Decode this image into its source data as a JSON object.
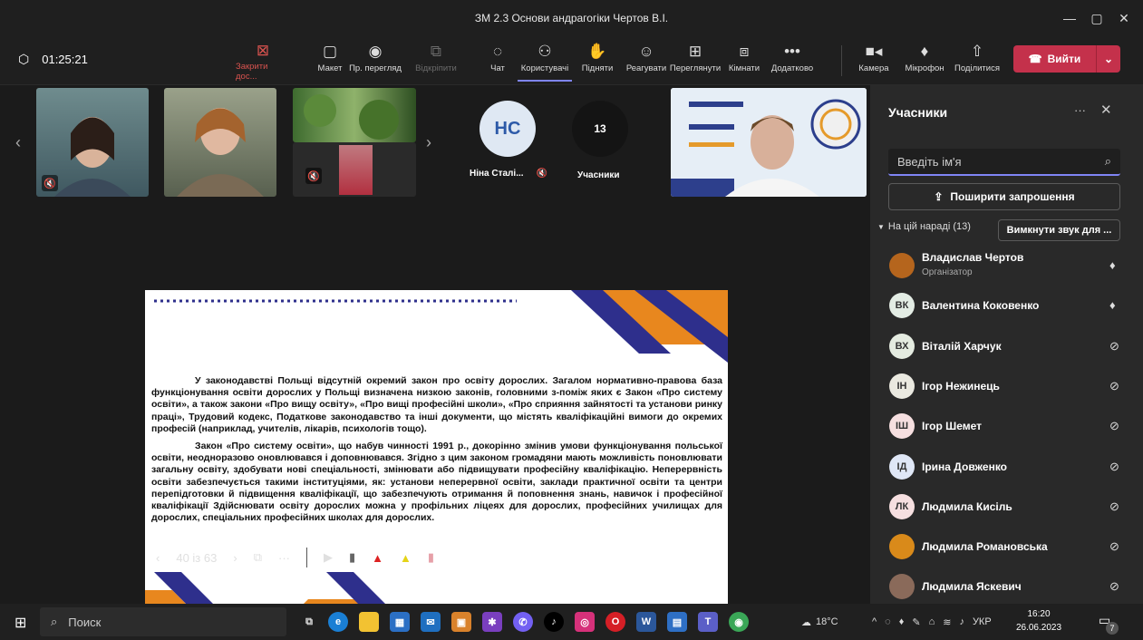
{
  "window": {
    "title": "ЗМ 2.3 Основи андрагогіки Чертов В.І.",
    "minimize": "—",
    "maximize": "▢",
    "close": "✕"
  },
  "meeting": {
    "timer": "01:25:21"
  },
  "toolbar": {
    "buttons": [
      {
        "label": "Закрити дос...",
        "icon": "close-share-icon",
        "glyph": "⊠"
      },
      {
        "label": "Макет",
        "icon": "layout-icon",
        "glyph": "▢"
      },
      {
        "label": "Пр. перегляд",
        "icon": "preview-eye-icon",
        "glyph": "◉"
      },
      {
        "label": "Відкріпити",
        "icon": "popout-icon",
        "glyph": "⧉"
      },
      {
        "label": "Чат",
        "icon": "chat-icon",
        "glyph": "💬"
      },
      {
        "label": "Користувачі",
        "icon": "people-icon",
        "glyph": "👥"
      },
      {
        "label": "Підняти",
        "icon": "raise-hand-icon",
        "glyph": "✋"
      },
      {
        "label": "Реагувати",
        "icon": "react-smiley-icon",
        "glyph": "☺"
      },
      {
        "label": "Переглянути",
        "icon": "view-grid-icon",
        "glyph": "⊞"
      },
      {
        "label": "Кімнати",
        "icon": "rooms-icon",
        "glyph": "⧈"
      },
      {
        "label": "Додатково",
        "icon": "more-icon",
        "glyph": "•••"
      },
      {
        "label": "Камера",
        "icon": "camera-icon",
        "glyph": "■"
      },
      {
        "label": "Мікрофон",
        "icon": "microphone-icon",
        "glyph": "🎙"
      },
      {
        "label": "Поділитися",
        "icon": "share-icon",
        "glyph": "⇧"
      }
    ],
    "leave_label": "Вийти"
  },
  "gallery": {
    "nina_name": "Ніна Сталі...",
    "nina_initials": "НС",
    "participants_count": "13",
    "participants_label": "Учасники"
  },
  "slide": {
    "paragraph1": "У законодавстві Польщі відсутній окремий закон про освіту дорослих. Загалом нормативно-правова база функціонування освіти дорослих у Польщі визначена низкою законів, головними з-поміж яких є Закон «Про систему освіти», а також закони «Про вищу освіту», «Про вищі професійні школи», «Про сприяння зайнятості та установи ринку праці», Трудовий кодекс, Податкове законодавство та інші документи, що містять кваліфікаційні вимоги до окремих професій (наприклад, учителів, лікарів, психологів тощо).",
    "paragraph2": "Закон «Про систему освіти», що набув чинності 1991 р., докорінно змінив умови функціонування польської освіти, неодноразово оновлювався і доповнювався. Згідно з цим законом громадяни мають можливість поновлювати загальну освіту, здобувати нові спеціальності, змінювати або підвищувати професійну кваліфікацію. Неперервність освіти забезпечується такими інституціями, як: установи неперервної освіти, заклади практичної освіти та центри перепідготовки й підвищення кваліфікації, що забезпечують отримання й поповнення знань, навичок і професійної кваліфікації Здійснювати освіту дорослих можна у профільних ліцеях для дорослих, професійних училищах для дорослих, спеціальних професійних школах для дорослих.",
    "page_indicator": "40 із 63"
  },
  "panel": {
    "title": "Учасники",
    "search_placeholder": "Введіть ім'я",
    "invite_label": "Поширити запрошення",
    "section_label": "На цій нараді (13)",
    "mute_all_label": "Вимкнути звук для ..."
  },
  "participants": [
    {
      "name": "Владислав Чертов",
      "role": "Організатор",
      "initials": "",
      "avatar_color": "#b5651d",
      "mic": "on"
    },
    {
      "name": "Валентина Коковенко",
      "role": "",
      "initials": "ВК",
      "avatar_color": "#e3ece4",
      "mic": "on"
    },
    {
      "name": "Віталій Харчук",
      "role": "",
      "initials": "ВХ",
      "avatar_color": "#e4ebe0",
      "mic": "off"
    },
    {
      "name": "Ігор Нежинець",
      "role": "",
      "initials": "ІН",
      "avatar_color": "#eae9e0",
      "mic": "off"
    },
    {
      "name": "Ігор Шемет",
      "role": "",
      "initials": "ІШ",
      "avatar_color": "#f6dfe0",
      "mic": "off"
    },
    {
      "name": "Ірина Довженко",
      "role": "",
      "initials": "ІД",
      "avatar_color": "#dfe7f6",
      "mic": "off"
    },
    {
      "name": "Людмила Кисіль",
      "role": "",
      "initials": "ЛК",
      "avatar_color": "#f6dfe0",
      "mic": "off"
    },
    {
      "name": "Людмила Романовська",
      "role": "",
      "initials": "",
      "avatar_color": "#d98a1a",
      "mic": "off"
    },
    {
      "name": "Людмила Яскевич",
      "role": "",
      "initials": "",
      "avatar_color": "#8a6a5a",
      "mic": "off"
    }
  ],
  "taskbar": {
    "search_label": "Поиск",
    "weather": "18°C",
    "language": "УКР",
    "time": "16:20",
    "date": "26.06.2023",
    "notification_count": "7"
  }
}
